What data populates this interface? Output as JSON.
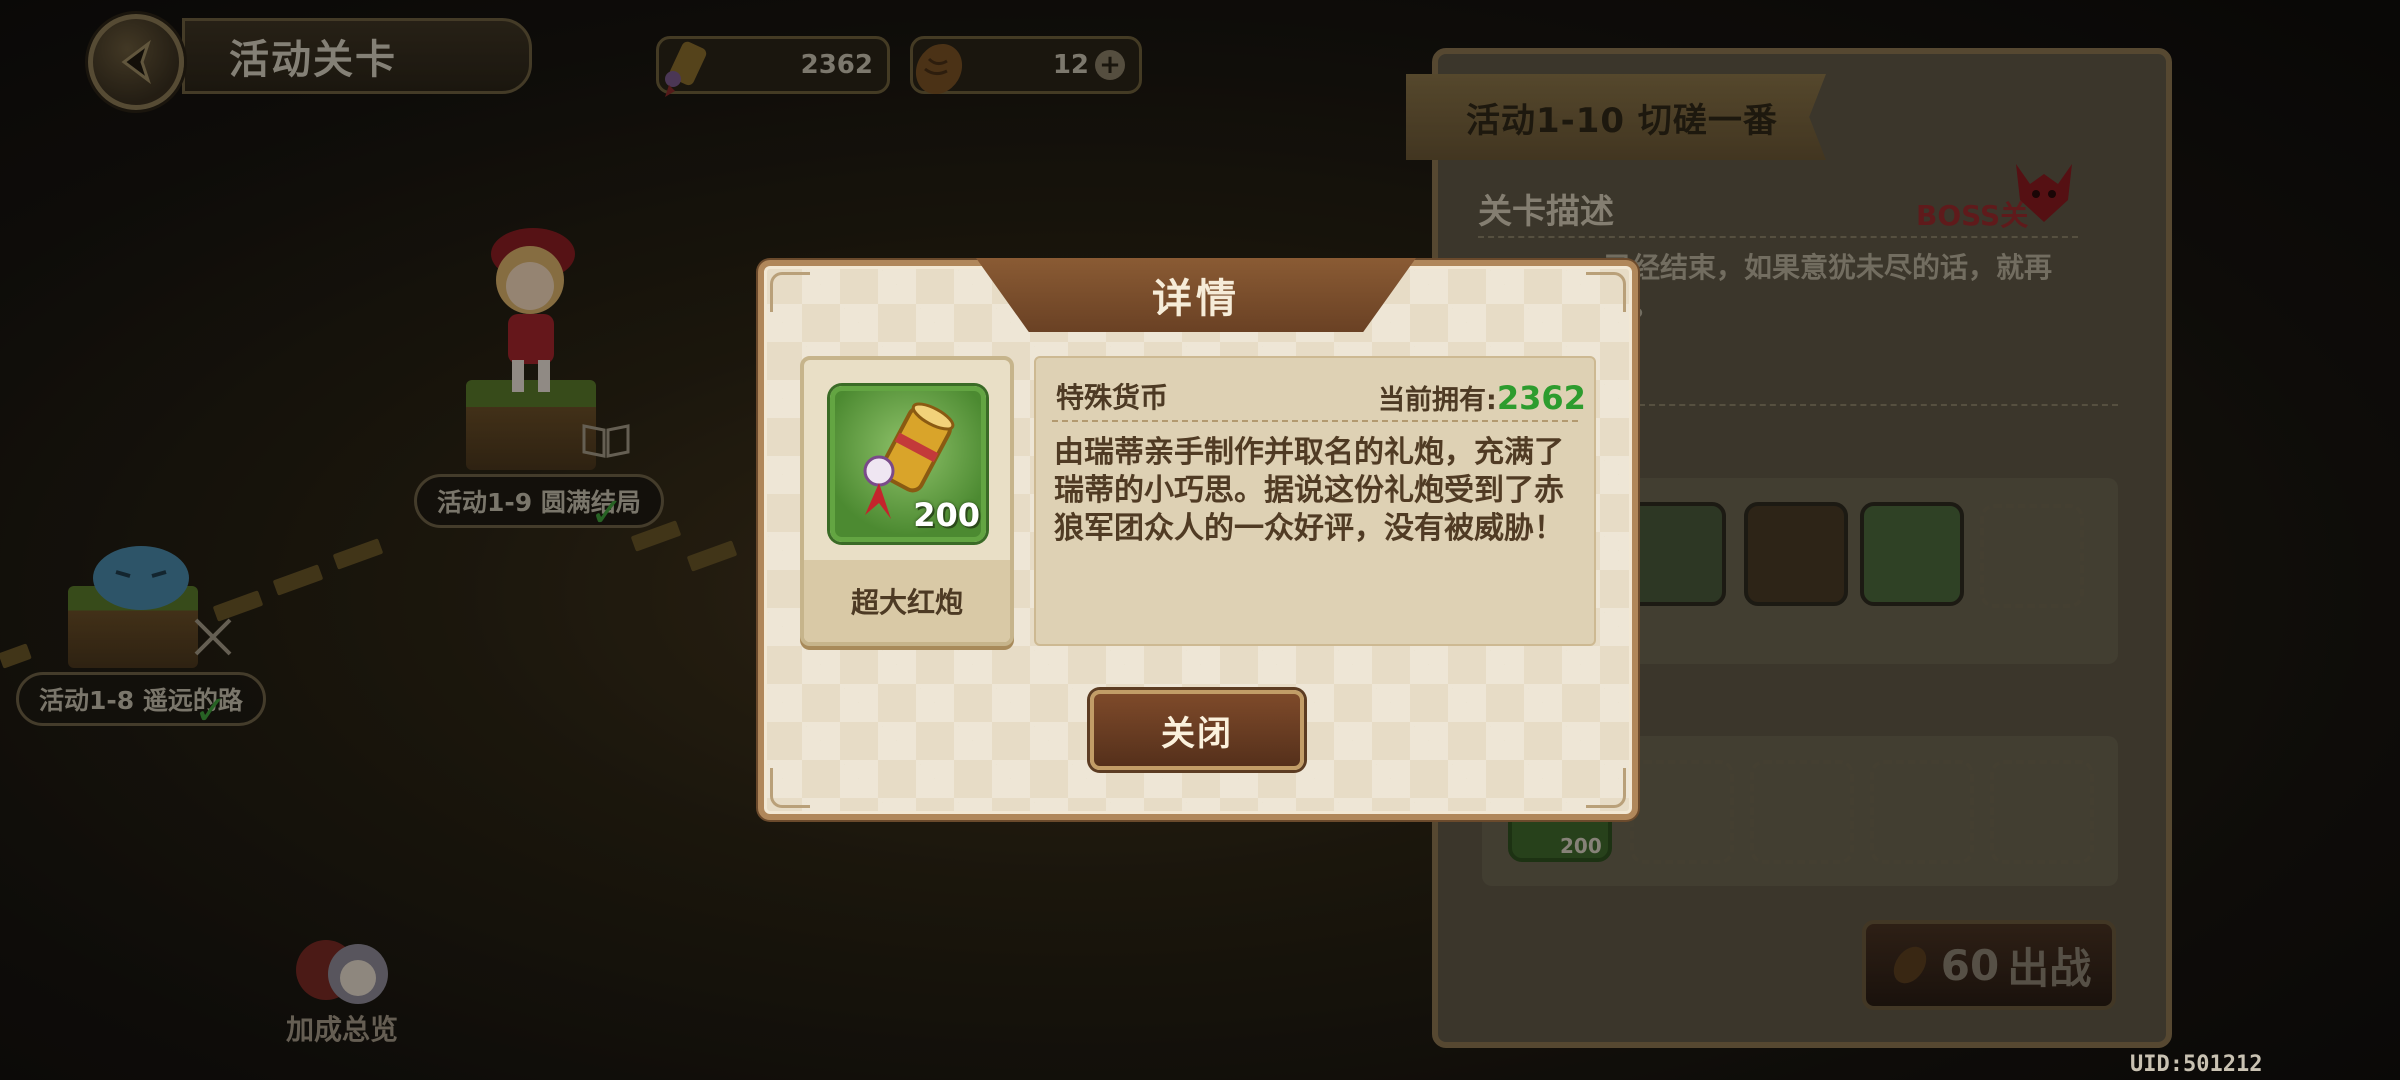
{
  "header": {
    "title": "活动关卡",
    "special_currency_count": "2362",
    "bread_count": "12"
  },
  "map": {
    "nodes": [
      {
        "label": "活动1-9 圆满结局",
        "cleared": true
      },
      {
        "label": "活动1-8 遥远的路",
        "cleared": true
      }
    ],
    "bonus_overview_label": "加成总览"
  },
  "stage_panel": {
    "stage_name": "活动1-10 切磋一番",
    "description_heading": "关卡描述",
    "boss_label": "BOSS关",
    "description_fragment_line1": "已经结束，如果意犹未尽的话，就再",
    "description_fragment_line2": "吧。",
    "reward_qty": "200",
    "battle_cost": "60",
    "battle_label": "出战"
  },
  "dialog": {
    "title": "详情",
    "item_name": "超大红炮",
    "item_qty": "200",
    "item_type": "特殊货币",
    "owned_label": "当前拥有:",
    "owned_value": "2362",
    "description": "由瑞蒂亲手制作并取名的礼炮，充满了瑞蒂的小巧思。据说这份礼炮受到了赤狼军团众人的一众好评，没有被威胁！",
    "close_label": "关闭"
  },
  "footer": {
    "uid": "UID:501212"
  },
  "colors": {
    "owned_value": "#2d9c2e",
    "dialog_bg": "#e7dcc6",
    "close_button": "#7e4a2a",
    "item_frame": "#63a542"
  },
  "icons": [
    "back-arrow-icon",
    "party-cannon-icon",
    "bread-icon",
    "plus-icon",
    "book-icon",
    "crossed-swords-icon",
    "boss-demon-icon"
  ]
}
